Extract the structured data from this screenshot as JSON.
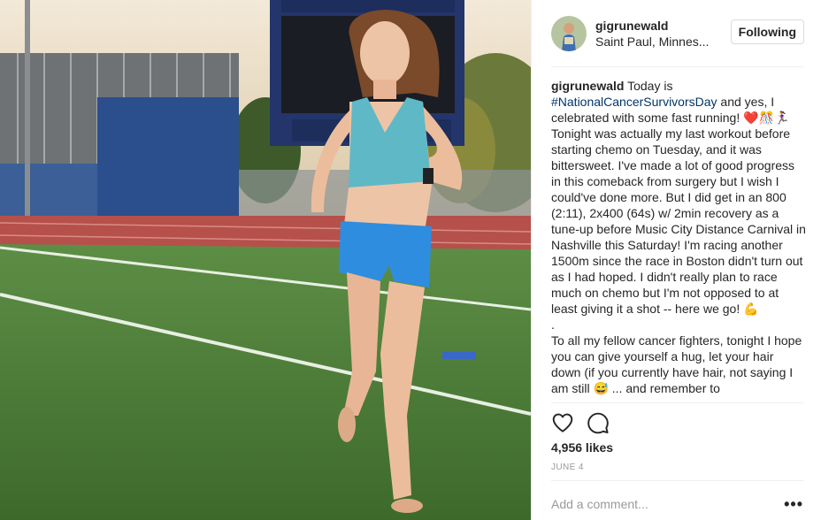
{
  "post": {
    "photo_alt": "Runner on track field",
    "header": {
      "username": "gigrunewald",
      "location": "Saint Paul, Minnes...",
      "follow_label": "Following"
    },
    "caption": {
      "username": "gigrunewald",
      "intro": " Today is ",
      "hashtag": "#NationalCancerSurvivorsDay",
      "part1": " and yes, I celebrated with some fast running! ",
      "emoji1": "❤️",
      "emoji2": "🎊🏃‍♀",
      "part2": " Tonight was actually my last workout before starting chemo on Tuesday, and it was bittersweet. I've made a lot of good progress in this comeback from surgery but I wish I could've done more. But I did get in an 800 (2:11), 2x400 (64s) w/ 2min recovery as a tune-up before Music City Distance Carnival in Nashville this Saturday! I'm racing another 1500m since the race in Boston didn't turn out as I had hoped. I didn't really plan to race much on chemo but I'm not opposed to at least giving it a shot -- here we go! ",
      "emoji3": "💪",
      "dot": ".",
      "part3": "To all my fellow cancer fighters, tonight I hope you can give yourself a hug, let your hair down (if you currently have hair, not saying I am still 😅 ... and remember to"
    },
    "likes": "4,956 likes",
    "date": "JUNE 4",
    "comment_placeholder": "Add a comment...",
    "more_label": "•••",
    "icons": {
      "like": "heart-outline-icon",
      "comment": "speech-bubble-icon",
      "more": "more-options-icon"
    },
    "colors": {
      "hashtag": "#003569",
      "text": "#262626",
      "muted": "#999999",
      "border": "#dbdbdb"
    }
  }
}
